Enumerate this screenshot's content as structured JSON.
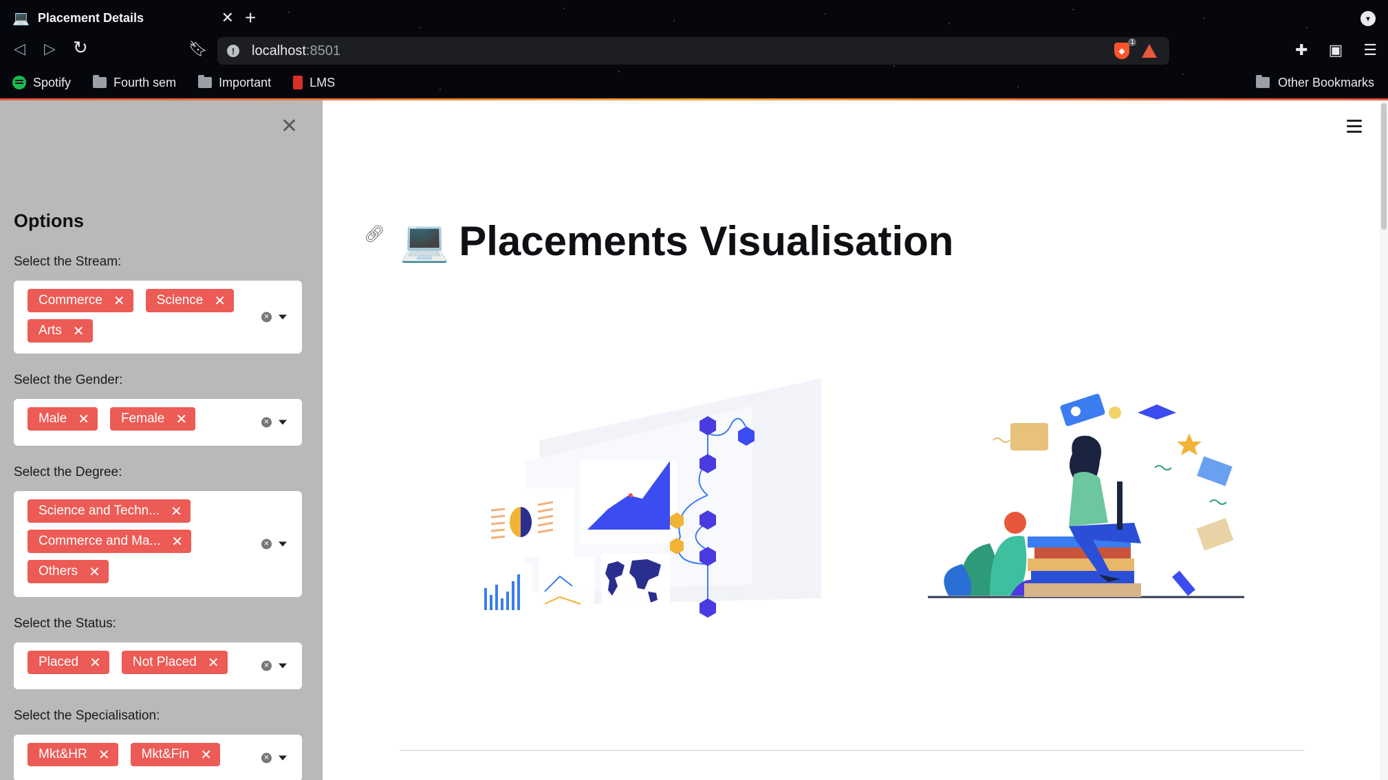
{
  "browser": {
    "tab_title": "Placement Details",
    "tab_favicon": "💻",
    "url_host": "localhost",
    "url_port": ":8501",
    "shield_count": "1",
    "bookmarks": [
      {
        "label": "Spotify",
        "icon": "spotify-icon"
      },
      {
        "label": "Fourth sem",
        "icon": "folder-icon"
      },
      {
        "label": "Important",
        "icon": "folder-icon"
      },
      {
        "label": "LMS",
        "icon": "lms-icon"
      }
    ],
    "other_bookmarks": "Other Bookmarks"
  },
  "sidebar": {
    "title": "Options",
    "filters": [
      {
        "label": "Select the Stream:",
        "chips": [
          "Commerce",
          "Science",
          "Arts"
        ]
      },
      {
        "label": "Select the Gender:",
        "chips": [
          "Male",
          "Female"
        ]
      },
      {
        "label": "Select the Degree:",
        "chips": [
          "Science and Techn...",
          "Commerce and Ma...",
          "Others"
        ]
      },
      {
        "label": "Select the Status:",
        "chips": [
          "Placed",
          "Not Placed"
        ]
      },
      {
        "label": "Select the Specialisation:",
        "chips": [
          "Mkt&HR",
          "Mkt&Fin"
        ]
      }
    ]
  },
  "main": {
    "title_emoji": "💻",
    "title": "Placements Visualisation"
  },
  "colors": {
    "chip": "#ec5b55",
    "sidebar_bg": "#b9b9b9",
    "accent_blue": "#3b4cf0",
    "accent_orange": "#f2b336"
  }
}
